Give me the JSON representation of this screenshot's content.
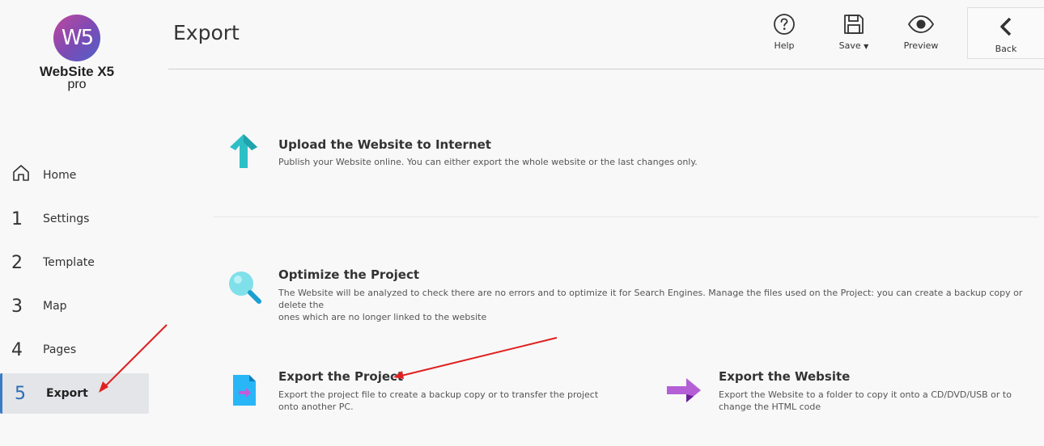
{
  "app": {
    "logo_mark": "W5",
    "logo_name": "WebSite X5",
    "logo_edition": "pro"
  },
  "header": {
    "title": "Export",
    "toolbar": {
      "help_label": "Help",
      "save_label": "Save",
      "preview_label": "Preview",
      "back_label": "Back"
    }
  },
  "sidebar": {
    "items": [
      {
        "num": "",
        "icon": "home-icon",
        "label": "Home"
      },
      {
        "num": "1",
        "label": "Settings"
      },
      {
        "num": "2",
        "label": "Template"
      },
      {
        "num": "3",
        "label": "Map"
      },
      {
        "num": "4",
        "label": "Pages"
      },
      {
        "num": "5",
        "label": "Export",
        "active": true
      }
    ]
  },
  "main": {
    "upload": {
      "title": "Upload the Website to Internet",
      "desc": "Publish your Website online. You can either export the whole website or the last changes only."
    },
    "optimize": {
      "title": "Optimize the Project",
      "desc_line1": "The Website will be analyzed to check there are no errors and to optimize it for Search Engines. Manage the files used on the Project: you can create a backup copy or delete the",
      "desc_line2": "ones which are no longer linked to the website"
    },
    "export_project": {
      "title": "Export the Project",
      "desc_line1": "Export the project file to create a backup copy or to transfer the project",
      "desc_line2": "onto another PC."
    },
    "export_website": {
      "title": "Export the Website",
      "desc_line1": "Export the Website to a folder to copy it onto a CD/DVD/USB or to",
      "desc_line2": "change the HTML code"
    }
  },
  "colors": {
    "accent_blue": "#3a7cc4",
    "upload_arrow": "#2ebfc6",
    "magnifier": "#7fe0ea",
    "file_icon": "#29b6f6",
    "export_arrow": "#b45fd6",
    "annotation_red": "#e02020"
  }
}
